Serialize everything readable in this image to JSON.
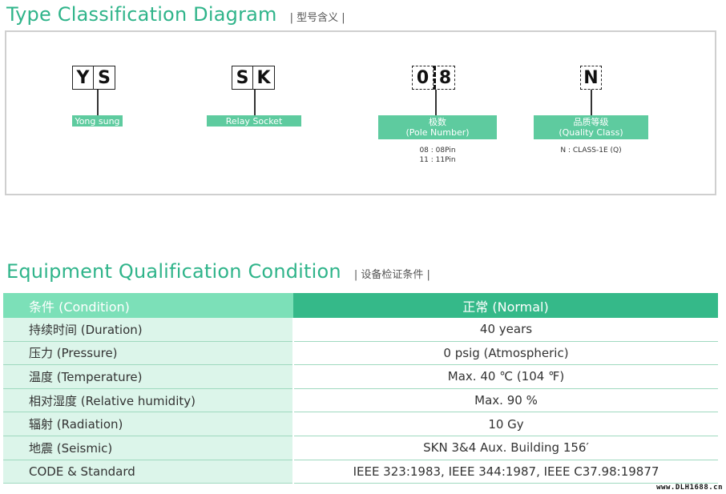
{
  "section1": {
    "title": "Type Classification Diagram",
    "subtitle": "| 型号含义 |"
  },
  "diagram": {
    "groups": [
      {
        "letters": [
          "Y",
          "S"
        ],
        "label_line1": "Yong sung",
        "label_line2": "",
        "note_line1": "",
        "note_line2": ""
      },
      {
        "letters": [
          "S",
          "K"
        ],
        "label_line1": "Relay Socket",
        "label_line2": "",
        "note_line1": "",
        "note_line2": ""
      },
      {
        "letters": [
          "0",
          "8"
        ],
        "label_line1": "极数",
        "label_line2": "(Pole Number)",
        "note_line1": "08 : 08Pin",
        "note_line2": "11 : 11Pin"
      },
      {
        "letters": [
          "N"
        ],
        "label_line1": "品质等级",
        "label_line2": "(Quality Class)",
        "note_line1": "N : CLASS-1E (Q)",
        "note_line2": ""
      }
    ]
  },
  "section2": {
    "title": "Equipment Qualification Condition",
    "subtitle": "| 设备检证条件 |"
  },
  "table": {
    "header_left": "条件 (Condition)",
    "header_right": "正常 (Normal)",
    "rows": [
      {
        "condition": "持续时间 (Duration)",
        "value": "40 years"
      },
      {
        "condition": "压力 (Pressure)",
        "value": "0 psig (Atmospheric)"
      },
      {
        "condition": "温度 (Temperature)",
        "value": "Max. 40 ℃ (104 ℉)"
      },
      {
        "condition": "相对湿度 (Relative humidity)",
        "value": "Max. 90 %"
      },
      {
        "condition": "辐射 (Radiation)",
        "value": "10 Gy"
      },
      {
        "condition": "地震 (Seismic)",
        "value": "SKN 3&4 Aux. Building 156′"
      },
      {
        "condition": "CODE & Standard",
        "value": "IEEE 323:1983, IEEE 344:1987, IEEE C37.98:19877"
      }
    ]
  },
  "watermark": "www.DLH1688.cn",
  "colors": {
    "accent": "#2fb48a",
    "header_light": "#7ce0b8",
    "header_dark": "#35b989",
    "row_left": "#dcf5ea",
    "label_green": "#5ecb9f"
  }
}
